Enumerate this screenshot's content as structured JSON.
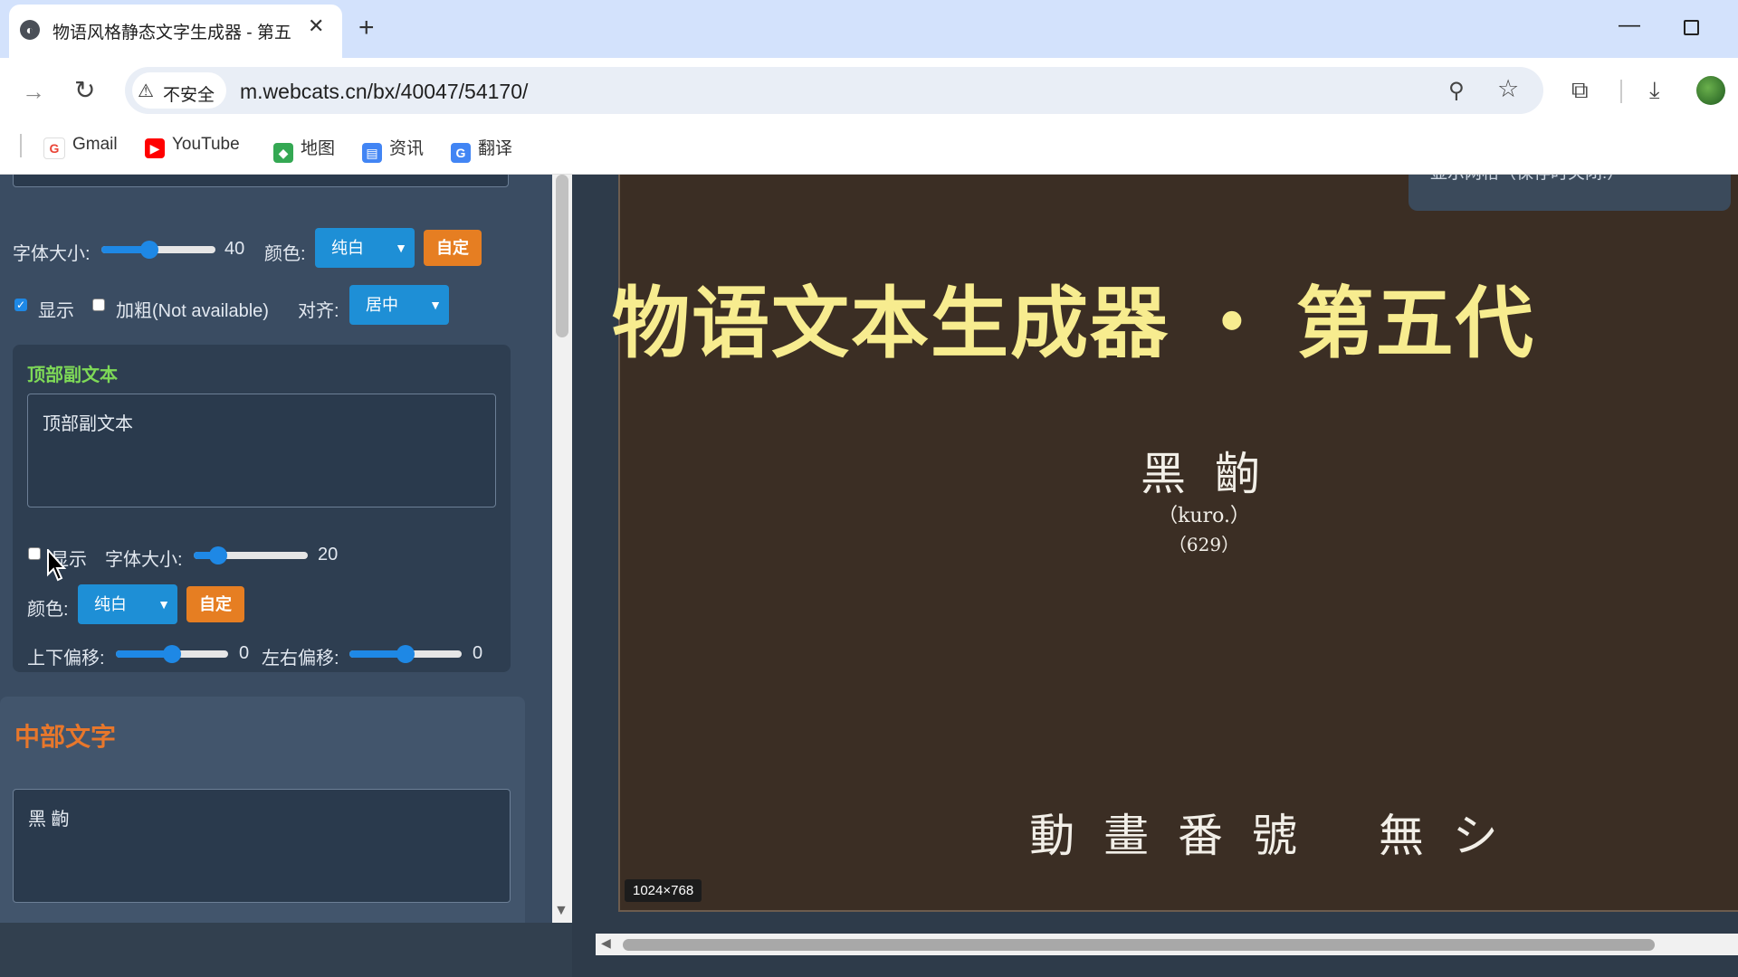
{
  "browser": {
    "tab_title": "物语风格静态文字生成器 - 第五",
    "new_tab": "+",
    "close_tab": "✕",
    "security_label": "不安全",
    "url": "m.webcats.cn/bx/40047/54170/",
    "bookmarks": [
      {
        "label": "Gmail",
        "icon": "gmail-icon",
        "color": "#ea4335"
      },
      {
        "label": "YouTube",
        "icon": "youtube-icon",
        "color": "#ff0000"
      },
      {
        "label": "地图",
        "icon": "maps-icon",
        "color": "#34a853"
      },
      {
        "label": "资讯",
        "icon": "news-icon",
        "color": "#4285f4"
      },
      {
        "label": "翻译",
        "icon": "translate-icon",
        "color": "#4285f4"
      }
    ]
  },
  "top_settings": {
    "font_size_label": "字体大小:",
    "font_size_value": "40",
    "font_size_fraction": 0.42,
    "color_label": "颜色:",
    "color_value": "纯白",
    "custom_button": "自定",
    "show_label": "显示",
    "show_checked": true,
    "bold_label": "加粗(Not available)",
    "bold_checked": false,
    "align_label": "对齐:",
    "align_value": "居中"
  },
  "top_subtext": {
    "title": "顶部副文本",
    "text": "顶部副文本",
    "show_label": "显示",
    "show_checked": false,
    "font_size_label": "字体大小:",
    "font_size_value": "20",
    "font_size_fraction": 0.2,
    "color_label": "颜色:",
    "color_value": "纯白",
    "custom_button": "自定",
    "v_offset_label": "上下偏移:",
    "v_offset_value": "0",
    "v_offset_fraction": 0.5,
    "h_offset_label": "左右偏移:",
    "h_offset_value": "0",
    "h_offset_fraction": 0.5
  },
  "middle_text": {
    "title": "中部文字",
    "text": "黑 齣"
  },
  "preview": {
    "main_title": "物语文本生成器 ・ 第五代",
    "center_text": "黑 齣",
    "center_sub1": "（kuro.）",
    "center_sub2": "（629）",
    "bottom_text": "動 畫 番 號 　無 シ",
    "size_badge": "1024×768",
    "float_panel_text": "显示网格（保存时关闭!）",
    "background_color": "#3b2e24",
    "title_color": "#f7ec8f"
  }
}
